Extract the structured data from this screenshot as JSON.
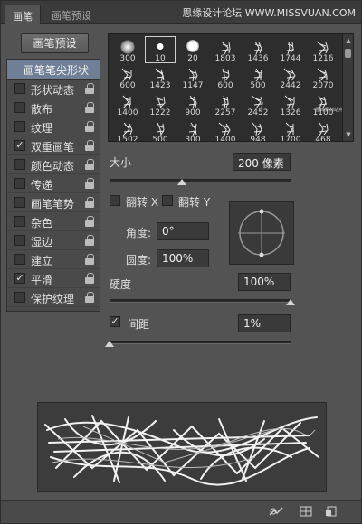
{
  "tabs": [
    {
      "label": "画笔"
    },
    {
      "label": "画笔预设"
    }
  ],
  "watermark": "思缘设计论坛 WWW.MISSVUAN.COM",
  "preset_button": "画笔预设",
  "options": {
    "header": "画笔笔尖形状",
    "items": [
      {
        "label": "形状动态",
        "checked": false
      },
      {
        "label": "散布",
        "checked": false
      },
      {
        "label": "纹理",
        "checked": false
      },
      {
        "label": "双重画笔",
        "checked": true
      },
      {
        "label": "颜色动态",
        "checked": false
      },
      {
        "label": "传递",
        "checked": false
      },
      {
        "label": "画笔笔势",
        "checked": false
      },
      {
        "label": "杂色",
        "checked": false
      },
      {
        "label": "湿边",
        "checked": false
      },
      {
        "label": "建立",
        "checked": false
      },
      {
        "label": "平滑",
        "checked": true
      },
      {
        "label": "保护纹理",
        "checked": false
      }
    ],
    "check_glyph": "✓"
  },
  "brushes": {
    "row1": [
      "300",
      "10",
      "20",
      "1803",
      "1436",
      "1744",
      "1216"
    ],
    "row2": [
      "600",
      "1423",
      "1147",
      "600",
      "500",
      "2442",
      "2070"
    ],
    "row3": [
      "1400",
      "1222",
      "900",
      "2257",
      "2452",
      "1326",
      "1100"
    ],
    "row4": [
      "1502",
      "500",
      "300",
      "1400",
      "948",
      "1700",
      "468"
    ],
    "selected": "10",
    "row3_tile_caption": "图库素材站点"
  },
  "size": {
    "label": "大小",
    "value": "200 像素",
    "fraction": 0.4
  },
  "flip_x": {
    "label": "翻转 X",
    "checked": false
  },
  "flip_y": {
    "label": "翻转 Y",
    "checked": false
  },
  "angle": {
    "label": "角度:",
    "value": "0°"
  },
  "roundness": {
    "label": "圆度:",
    "value": "100%"
  },
  "hardness": {
    "label": "硬度",
    "value": "100%",
    "fraction": 1.0
  },
  "spacing": {
    "label": "间距",
    "value": "1%",
    "checked": true,
    "fraction": 0.0
  },
  "colors": {
    "header_bg": "#6f7f96",
    "panel_bg": "#535353"
  }
}
